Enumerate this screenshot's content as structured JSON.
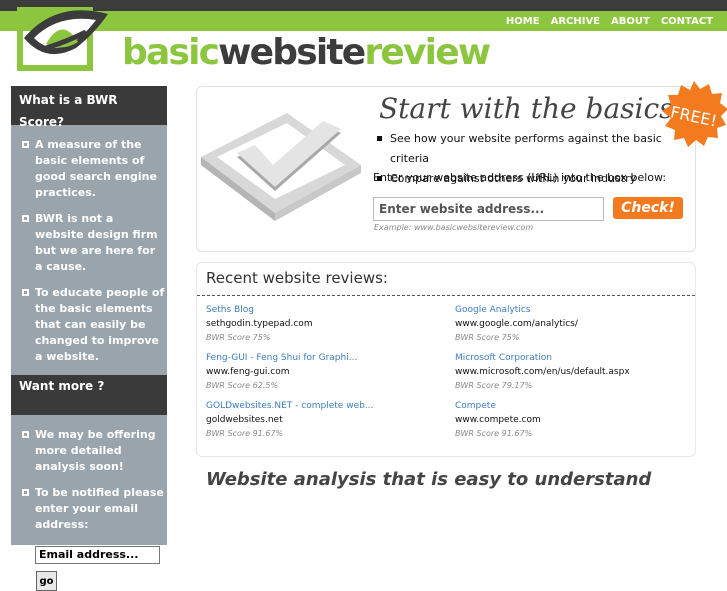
{
  "nav": [
    "HOME",
    "ARCHIVE",
    "ABOUT",
    "CONTACT"
  ],
  "brand": {
    "part1": "basic",
    "part2": "website",
    "part3": "review",
    "colors": {
      "green": "#8cc63e",
      "dark": "#3c3c3c",
      "orange": "#f47a1f",
      "link": "#3a7dc9"
    }
  },
  "sidebar": {
    "heading1": "What is a BWR Score?",
    "points1": [
      "A measure of the basic elements of good search engine practices.",
      "BWR is not a website design firm but we are here for a cause.",
      "To educate people of the basic elements that can easily be changed to improve a website."
    ],
    "heading2": "Want more ?",
    "points2": [
      "We may be offering more detailed analysis soon!",
      "To be notified please enter your email address:"
    ],
    "email_value": "Email address...",
    "go_label": "go"
  },
  "hero": {
    "title": "Start with the basics",
    "bullets": [
      "See how your website performs against the basic criteria",
      "Compare against others within your industry"
    ],
    "prompt": "Enter your website address (URL) into the box below:",
    "url_value": "Enter website address...",
    "check_label": "Check!",
    "example": "Example: www.basicwebsitereview.com",
    "badge": "FREE!"
  },
  "recent": {
    "title": "Recent website reviews:",
    "items": [
      {
        "name": "Seths Blog",
        "url": "sethgodin.typepad.com",
        "score": "BWR Score 75%"
      },
      {
        "name": "Google Analytics",
        "url": "www.google.com/analytics/",
        "score": "BWR Score 75%"
      },
      {
        "name": "Feng-GUI - Feng Shui for Graphi...",
        "url": "www.feng-gui.com",
        "score": "BWR Score 62.5%"
      },
      {
        "name": "Microsoft Corporation",
        "url": "www.microsoft.com/en/us/default.aspx",
        "score": "BWR Score 79.17%"
      },
      {
        "name": "GOLDwebsites.NET - complete web...",
        "url": "goldwebsites.net",
        "score": "BWR Score 91.67%"
      },
      {
        "name": "Compete",
        "url": "www.compete.com",
        "score": "BWR Score 91.67%"
      }
    ]
  },
  "tagline": "Website analysis that is easy to understand"
}
